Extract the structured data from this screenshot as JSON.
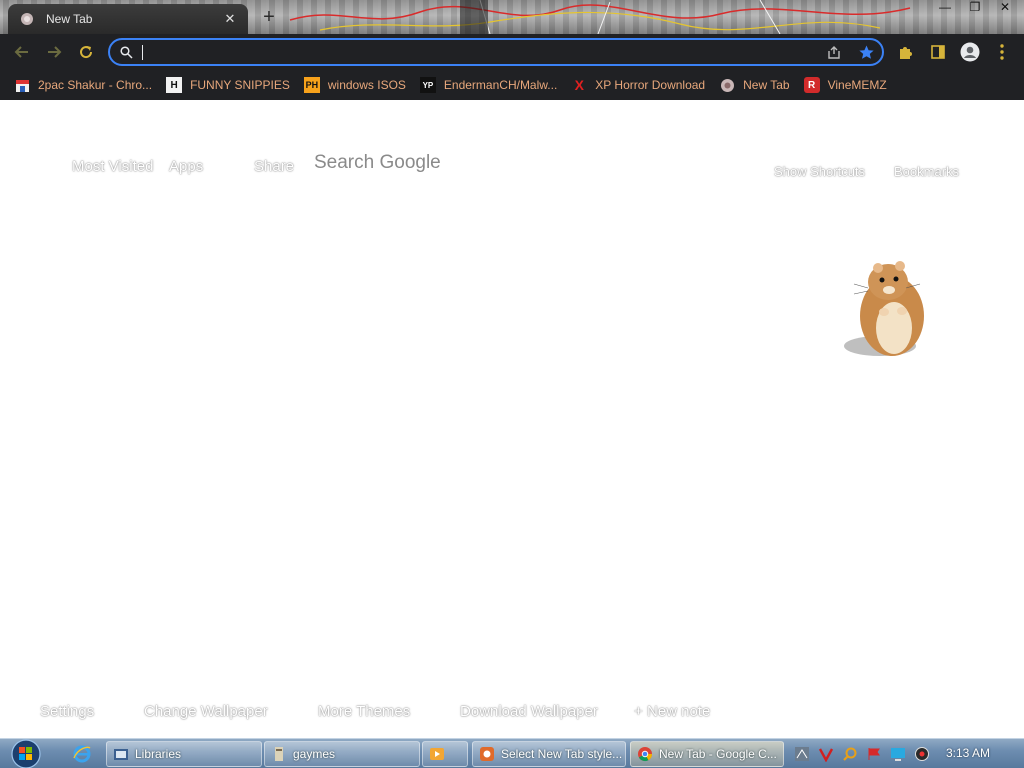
{
  "browser": {
    "tab": {
      "title": "New Tab",
      "close_icon": "close-icon"
    },
    "new_tab_icon": "plus-icon",
    "window_controls": [
      "minimize-icon",
      "restore-icon",
      "close-icon"
    ],
    "toolbar": {
      "back_icon": "arrow-left-icon",
      "forward_icon": "arrow-right-icon",
      "reload_icon": "reload-icon",
      "omnibox": {
        "value": "",
        "placeholder": ""
      },
      "share_icon": "share-icon",
      "bookmark_star_icon": "star-icon",
      "extensions_icon": "puzzle-icon",
      "sidepanel_icon": "sidepanel-icon",
      "profile_icon": "avatar-icon",
      "menu_icon": "kebab-menu-icon"
    },
    "bookmarks": [
      {
        "label": "2pac Shakur - Chro...",
        "icon_text": ""
      },
      {
        "label": "FUNNY SNIPPIES",
        "icon_text": "H"
      },
      {
        "label": "windows ISOS",
        "icon_text": "PH"
      },
      {
        "label": "EndermanCH/Malw...",
        "icon_text": "YP"
      },
      {
        "label": "XP Horror Download",
        "icon_text": "X"
      },
      {
        "label": "New Tab",
        "icon_text": ""
      },
      {
        "label": "VineMEMZ",
        "icon_text": "R"
      }
    ]
  },
  "newtab": {
    "top_links": {
      "most_visited": "Most Visited",
      "apps": "Apps",
      "share": "Share",
      "search": "Search Google",
      "show_shortcuts": "Show Shortcuts",
      "bookmarks": "Bookmarks"
    },
    "bottom_links": {
      "settings": "Settings",
      "change_wallpaper": "Change Wallpaper",
      "more_themes": "More Themes",
      "download_wallpaper": "Download Wallpaper",
      "new_note": "New note"
    }
  },
  "taskbar": {
    "items": [
      {
        "label": "Libraries"
      },
      {
        "label": "gaymes"
      },
      {
        "label": ""
      },
      {
        "label": "Select New Tab style..."
      },
      {
        "label": "New Tab - Google C..."
      }
    ],
    "clock": "3:13 AM"
  },
  "colors": {
    "accent": "#3b82f6",
    "bookmark_text": "#e8a87c",
    "toolbar_bg": "#202124"
  }
}
